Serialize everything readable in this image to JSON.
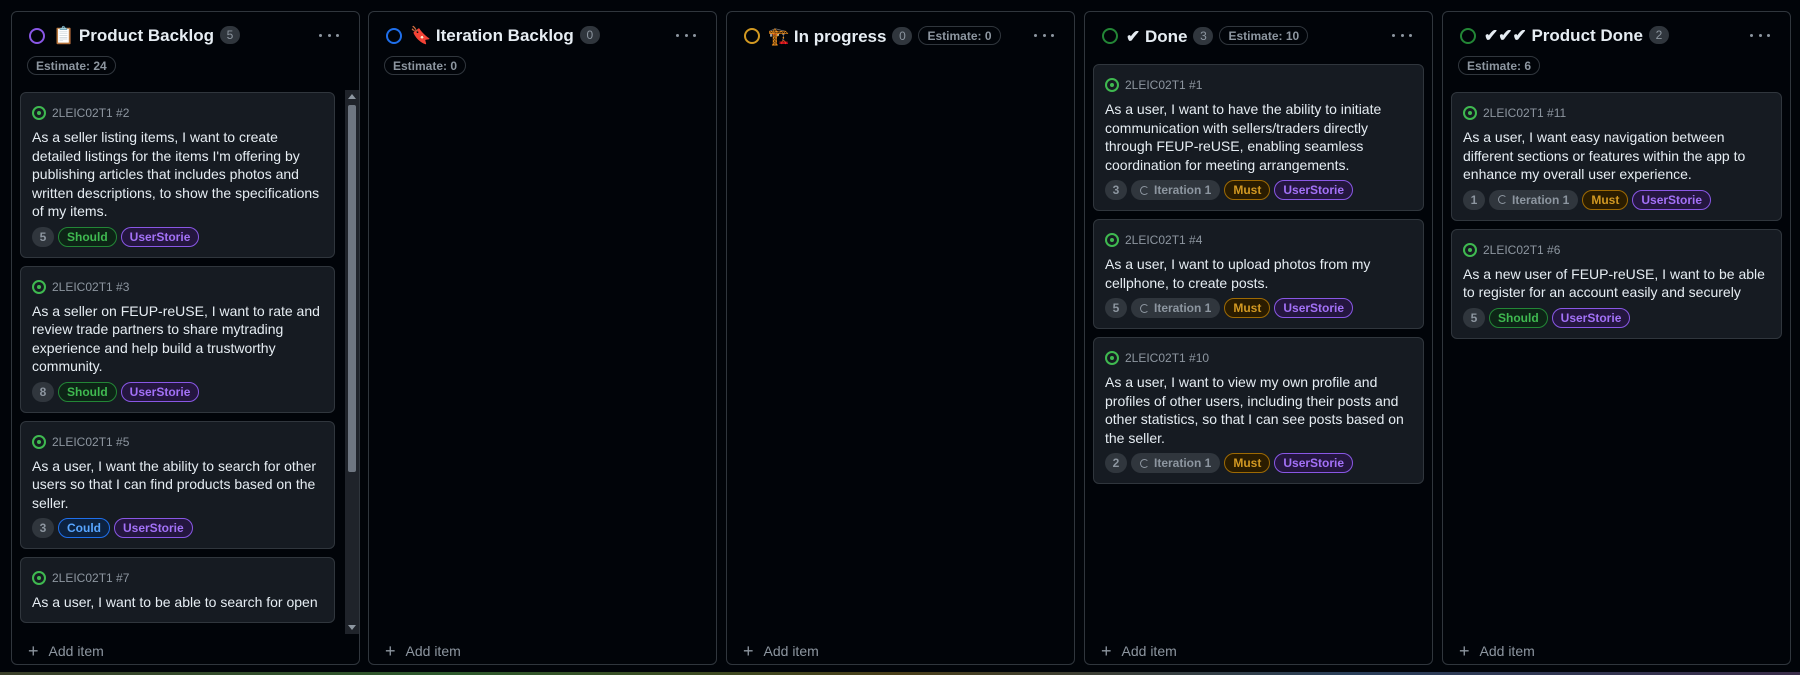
{
  "columns": [
    {
      "title": "📋 Product Backlog",
      "count": "5",
      "estimate": "Estimate: 24",
      "cards": [
        {
          "id": "2LEIC02T1 #2",
          "text": "As a seller listing items, I want to create detailed listings for the items I'm offering by publishing articles that includes photos and written descriptions, to show the specifications of my items.",
          "points": "5",
          "priority": "Should",
          "type": "UserStorie"
        },
        {
          "id": "2LEIC02T1 #3",
          "text": "As a seller on FEUP-reUSE, I want to rate and review trade partners to share mytrading experience and help build a trustworthy community.",
          "points": "8",
          "priority": "Should",
          "type": "UserStorie"
        },
        {
          "id": "2LEIC02T1 #5",
          "text": "As a user, I want the ability to search for other users so that I can find products based on the seller.",
          "points": "3",
          "priority": "Could",
          "type": "UserStorie"
        },
        {
          "id": "2LEIC02T1 #7",
          "text": "As a user, I want to be able to search for open"
        }
      ],
      "add_label": "Add item"
    },
    {
      "title": "🔖 Iteration Backlog",
      "count": "0",
      "estimate": "Estimate: 0",
      "add_label": "Add item"
    },
    {
      "title": "🏗️ In progress",
      "count": "0",
      "estimate": "Estimate: 0",
      "add_label": "Add item"
    },
    {
      "title": "✔ Done",
      "count": "3",
      "estimate": "Estimate: 10",
      "cards": [
        {
          "id": "2LEIC02T1 #1",
          "text": "As a user, I want to have the ability to initiate communication with sellers/traders directly through FEUP-reUSE, enabling seamless coordination for meeting arrangements.",
          "points": "3",
          "iteration": "Iteration 1",
          "priority": "Must",
          "type": "UserStorie"
        },
        {
          "id": "2LEIC02T1 #4",
          "text": "As a user, I want to upload photos from my cellphone, to create posts.",
          "points": "5",
          "iteration": "Iteration 1",
          "priority": "Must",
          "type": "UserStorie"
        },
        {
          "id": "2LEIC02T1 #10",
          "text": "As a user, I want to view my own profile and profiles of other users, including their posts and other statistics, so that I can see posts based on the seller.",
          "points": "2",
          "iteration": "Iteration 1",
          "priority": "Must",
          "type": "UserStorie"
        }
      ],
      "add_label": "Add item"
    },
    {
      "title": "✔✔✔ Product Done",
      "count": "2",
      "estimate": "Estimate: 6",
      "cards": [
        {
          "id": "2LEIC02T1 #11",
          "text": "As a user, I want easy navigation between different sections or features within the app to enhance my overall user experience.",
          "points": "1",
          "iteration": "Iteration 1",
          "priority": "Must",
          "type": "UserStorie"
        },
        {
          "id": "2LEIC02T1 #6",
          "text": "As a new user of FEUP-reUSE, I want to be able to register for an account easily and securely",
          "points": "5",
          "priority": "Should",
          "type": "UserStorie"
        }
      ],
      "add_label": "Add item"
    }
  ],
  "colors": {
    "background": "#010409",
    "card": "#161b22",
    "border": "#30363d",
    "open_issue": "#3fb950",
    "status_backlog": "#8957e5",
    "status_iteration": "#1f6feb",
    "status_progress": "#d29922",
    "status_done": "#238636"
  },
  "icons": {
    "status": "status-circle-icon",
    "more": "more-horizontal-icon",
    "issue": "issue-opened-icon",
    "iteration": "iteration-icon",
    "add": "plus-icon"
  }
}
